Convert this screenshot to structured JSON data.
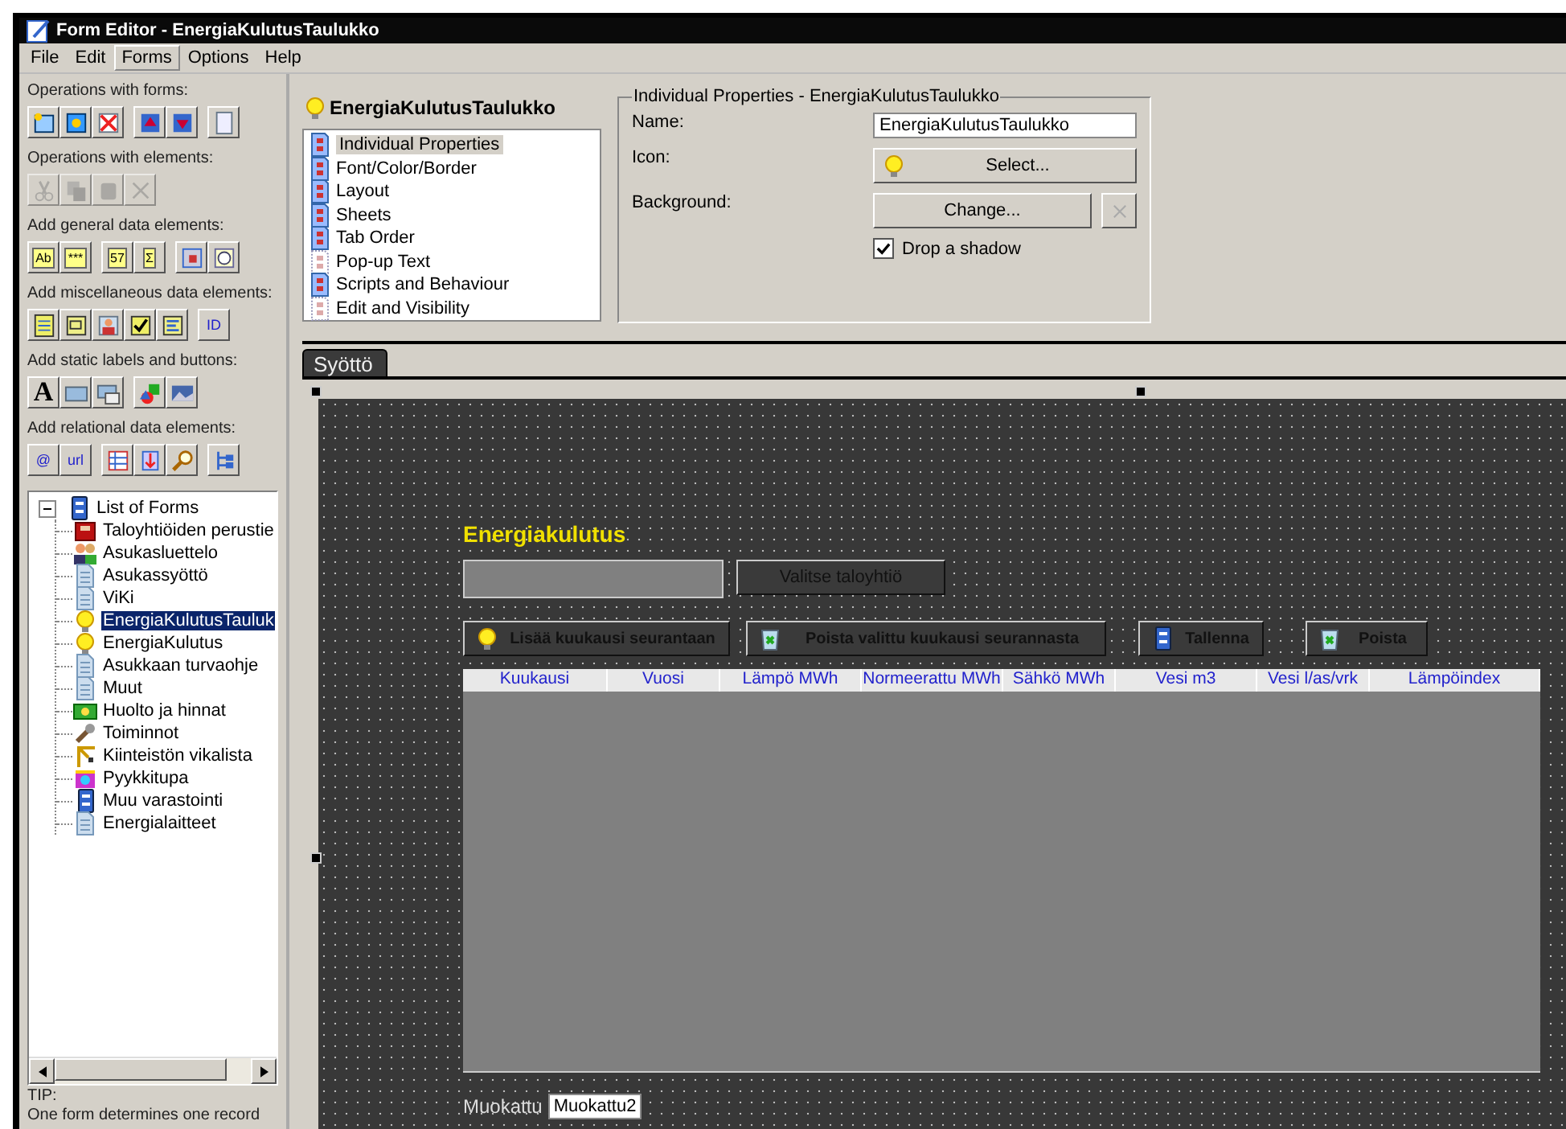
{
  "window": {
    "title": "Form Editor - EnergiaKulutusTaulukko"
  },
  "menu": [
    {
      "label": "File",
      "selected": false
    },
    {
      "label": "Edit",
      "selected": false
    },
    {
      "label": "Forms",
      "selected": true
    },
    {
      "label": "Options",
      "selected": false
    },
    {
      "label": "Help",
      "selected": false
    }
  ],
  "toolbox": [
    {
      "label": "Operations with forms:",
      "disabled": false,
      "groups": [
        [
          {
            "kind": "new"
          },
          {
            "kind": "open"
          },
          {
            "kind": "delete"
          }
        ],
        [
          {
            "kind": "up"
          },
          {
            "kind": "down"
          }
        ],
        [
          {
            "kind": "page"
          }
        ]
      ]
    },
    {
      "label": "Operations with elements:",
      "disabled": true,
      "groups": [
        [
          {
            "kind": "cut"
          },
          {
            "kind": "copy"
          },
          {
            "kind": "paste"
          },
          {
            "kind": "remove"
          }
        ]
      ]
    },
    {
      "label": "Add general data elements:",
      "disabled": false,
      "groups": [
        [
          {
            "kind": "field",
            "text": "Ab"
          },
          {
            "kind": "field",
            "text": "***"
          }
        ],
        [
          {
            "kind": "field",
            "text": "57"
          },
          {
            "kind": "field",
            "text": "Σ"
          }
        ],
        [
          {
            "kind": "date"
          },
          {
            "kind": "time"
          }
        ]
      ]
    },
    {
      "label": "Add miscellaneous data elements:",
      "disabled": false,
      "groups": [
        [
          {
            "kind": "table"
          },
          {
            "kind": "combo"
          },
          {
            "kind": "person"
          },
          {
            "kind": "check"
          },
          {
            "kind": "list"
          }
        ],
        [
          {
            "kind": "code",
            "text": "ID"
          }
        ]
      ]
    },
    {
      "label": "Add static labels and buttons:",
      "disabled": false,
      "groups": [
        [
          {
            "kind": "letter",
            "text": "A"
          },
          {
            "kind": "rect"
          },
          {
            "kind": "spin"
          }
        ],
        [
          {
            "kind": "shapes"
          },
          {
            "kind": "picture"
          }
        ]
      ]
    },
    {
      "label": "Add relational data elements:",
      "disabled": false,
      "groups": [
        [
          {
            "kind": "code",
            "text": "@"
          },
          {
            "kind": "code",
            "text": "url"
          }
        ],
        [
          {
            "kind": "grid"
          },
          {
            "kind": "split"
          },
          {
            "kind": "search"
          }
        ],
        [
          {
            "kind": "tree"
          }
        ]
      ]
    }
  ],
  "tree": {
    "label": "List of Forms",
    "kind": "server",
    "expanded": true,
    "children": [
      {
        "label": "Taloyhtiöiden perustie",
        "kind": "book",
        "selected": false
      },
      {
        "label": "Asukasluettelo",
        "kind": "people",
        "selected": false
      },
      {
        "label": "Asukassyöttö",
        "kind": "doc",
        "selected": false
      },
      {
        "label": "ViKi",
        "kind": "doc",
        "selected": false
      },
      {
        "label": "EnergiaKulutusTauluk",
        "kind": "bulb",
        "selected": true
      },
      {
        "label": "EnergiaKulutus",
        "kind": "bulb",
        "selected": false
      },
      {
        "label": "Asukkaan turvaohje",
        "kind": "doc",
        "selected": false
      },
      {
        "label": "Muut",
        "kind": "doc",
        "selected": false
      },
      {
        "label": "Huolto ja hinnat",
        "kind": "money",
        "selected": false
      },
      {
        "label": "Toiminnot",
        "kind": "tools",
        "selected": false
      },
      {
        "label": "Kiinteistön vikalista",
        "kind": "crane",
        "selected": false
      },
      {
        "label": "Pyykkitupa",
        "kind": "laundry",
        "selected": false
      },
      {
        "label": "Muu varastointi",
        "kind": "server",
        "selected": false
      },
      {
        "label": "Energialaitteet",
        "kind": "doc",
        "selected": false
      }
    ]
  },
  "tip": {
    "title": "TIP:",
    "text": "One form determines one record"
  },
  "element": {
    "title": "EnergiaKulutusTaulukko",
    "pages": [
      {
        "label": "Individual Properties",
        "kind": "page",
        "selected": true
      },
      {
        "label": "Font/Color/Border",
        "kind": "page",
        "selected": false
      },
      {
        "label": "Layout",
        "kind": "page",
        "selected": false
      },
      {
        "label": "Sheets",
        "kind": "page",
        "selected": false
      },
      {
        "label": "Tab Order",
        "kind": "page",
        "selected": false
      },
      {
        "label": "Pop-up Text",
        "kind": "faded",
        "selected": false
      },
      {
        "label": "Scripts and Behaviour",
        "kind": "page",
        "selected": false
      },
      {
        "label": "Edit and Visibility",
        "kind": "faded",
        "selected": false
      }
    ]
  },
  "properties": {
    "title": "Individual Properties - EnergiaKulutusTaulukko",
    "name_label": "Name:",
    "name_value": "EnergiaKulutusTaulukko",
    "icon_label": "Icon:",
    "icon_button": "Select...",
    "background_label": "Background:",
    "background_button": "Change...",
    "clear_disabled": true,
    "shadow": {
      "label": "Drop a shadow",
      "checked": true
    }
  },
  "tabs": [
    {
      "label": "Syöttö",
      "selected": true
    }
  ],
  "form": {
    "heading": "Energiakulutus",
    "choose_button": "Valitse taloyhtiö",
    "actions": [
      {
        "label": "Lisää kuukausi seurantaan",
        "kind": "bulb"
      },
      {
        "label": "Poista valittu kuukausi seurannasta",
        "kind": "bin"
      },
      {
        "label": "Tallenna",
        "kind": "server"
      },
      {
        "label": "Poista",
        "kind": "bin"
      }
    ],
    "columns": [
      "Kuukausi",
      "Vuosi",
      "Lämpö MWh",
      "Normeerattu MWh",
      "Sähkö MWh",
      "Vesi m3",
      "Vesi l/as/vrk",
      "Lämpöindex"
    ],
    "modified_label": "Muokattu",
    "modified_value": "Muokattu2"
  }
}
